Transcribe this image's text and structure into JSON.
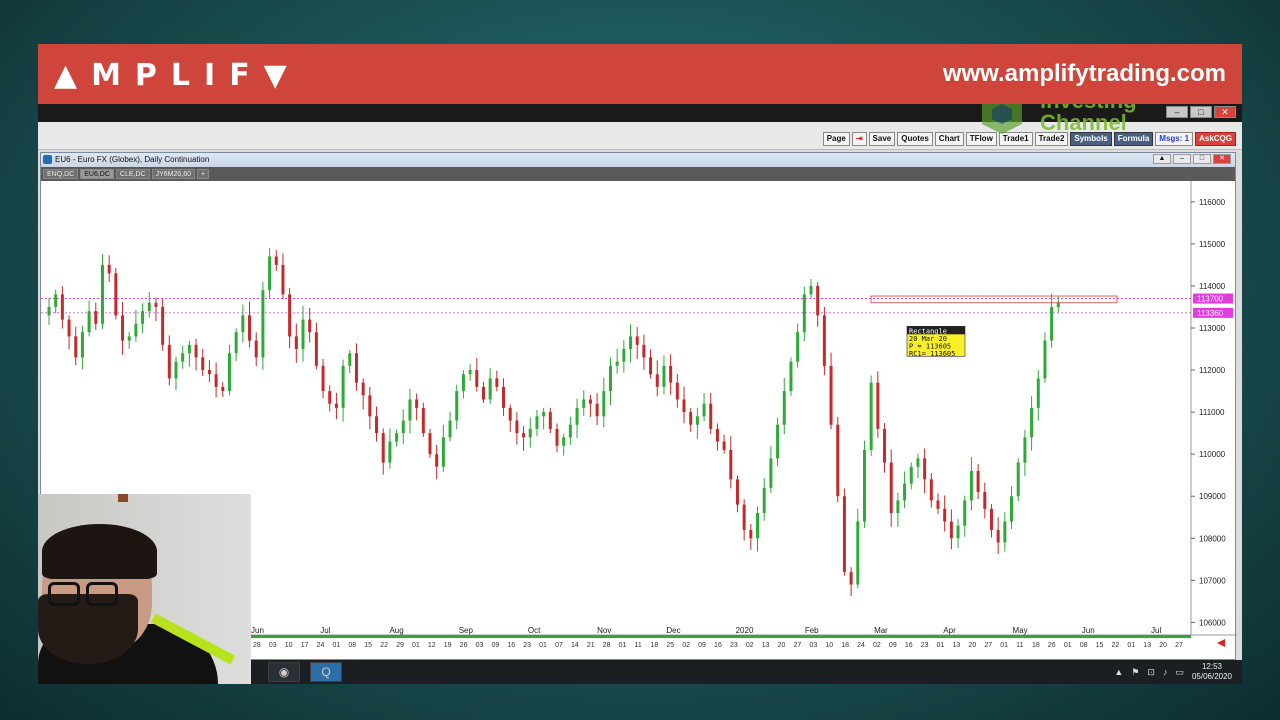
{
  "banner": {
    "brand": "▲MPLIF▼",
    "site_url": "www.amplifytrading.com",
    "brand_color": "#d0453b"
  },
  "watermark": {
    "line1": "Investing",
    "line2": "Channel"
  },
  "toolbar": {
    "buttons": [
      "Page",
      "⇥",
      "Save",
      "Quotes",
      "Chart",
      "TFlow",
      "Trade1",
      "Trade2",
      "Symbols",
      "Formula",
      "Msgs: 1",
      "AskCQG"
    ]
  },
  "chart_window": {
    "title": "EU6 - Euro FX (Globex), Daily Continuation",
    "symbol_tabs": [
      "ENQ,DC",
      "EU6,DC",
      "CLE,DC",
      "JY6M20,60",
      "+"
    ]
  },
  "annotation": {
    "lines": [
      "Rectangle",
      "20 Mar 20",
      "P  = 113605",
      "RC1= 113605"
    ]
  },
  "price_markers": {
    "upper": "113700",
    "lower": "113360"
  },
  "taskbar": {
    "time": "12:53",
    "date": "05/06/2020"
  },
  "chart_data": {
    "type": "candlestick",
    "title": "EU6 - Euro FX (Globex), Daily Continuation",
    "y_ticks": [
      "116000",
      "115000",
      "114000",
      "113000",
      "112000",
      "111000",
      "110000",
      "109000",
      "108000",
      "107000",
      "106000"
    ],
    "ylim": [
      105700,
      116400
    ],
    "month_labels": [
      "Jun",
      "Jul",
      "Aug",
      "Sep",
      "Oct",
      "Nov",
      "Dec",
      "2020",
      "Feb",
      "Mar",
      "Apr",
      "May",
      "Jun",
      "Jul"
    ],
    "day_ticks": [
      "28",
      "03",
      "10",
      "17",
      "24",
      "01",
      "08",
      "15",
      "22",
      "29",
      "01",
      "12",
      "19",
      "26",
      "03",
      "09",
      "16",
      "23",
      "01",
      "07",
      "14",
      "21",
      "28",
      "01",
      "11",
      "18",
      "25",
      "02",
      "09",
      "16",
      "23",
      "02",
      "13",
      "20",
      "27",
      "03",
      "10",
      "18",
      "24",
      "02",
      "09",
      "16",
      "23",
      "01",
      "13",
      "20",
      "27",
      "01",
      "11",
      "18",
      "26",
      "01",
      "08",
      "15",
      "22",
      "01",
      "13",
      "20",
      "27"
    ],
    "horizontal_lines": [
      113700,
      113360
    ],
    "close_series": [
      113500,
      113800,
      113200,
      112800,
      112300,
      112900,
      113400,
      113100,
      114500,
      114300,
      113300,
      112700,
      112800,
      113100,
      113400,
      113600,
      113500,
      112600,
      111800,
      112200,
      112400,
      112600,
      112300,
      112000,
      111900,
      111600,
      111500,
      112400,
      112900,
      113300,
      112700,
      112300,
      113900,
      114700,
      114500,
      113800,
      112800,
      112500,
      113200,
      112900,
      112100,
      111500,
      111200,
      111100,
      112100,
      112400,
      111700,
      111400,
      110900,
      110500,
      109800,
      110300,
      110500,
      110800,
      111300,
      111100,
      110500,
      110000,
      109700,
      110400,
      110800,
      111500,
      111900,
      112000,
      111600,
      111300,
      111800,
      111600,
      111100,
      110800,
      110500,
      110400,
      110600,
      110900,
      111000,
      110600,
      110200,
      110400,
      110700,
      111100,
      111300,
      111200,
      110900,
      111500,
      112100,
      112200,
      112500,
      112800,
      112600,
      112300,
      111900,
      111600,
      112100,
      111700,
      111300,
      111000,
      110700,
      110900,
      111200,
      110600,
      110300,
      110100,
      109400,
      108800,
      108200,
      108000,
      108600,
      109200,
      109900,
      110700,
      111500,
      112200,
      112900,
      113800,
      114000,
      113300,
      112100,
      110700,
      109000,
      107200,
      106900,
      108400,
      110100,
      111700,
      110600,
      109800,
      108600,
      108900,
      109300,
      109700,
      109900,
      109400,
      108900,
      108700,
      108400,
      108000,
      108300,
      108900,
      109600,
      109100,
      108700,
      108200,
      107900,
      108400,
      109000,
      109800,
      110400,
      111100,
      111800,
      112700,
      113500,
      113600
    ]
  }
}
